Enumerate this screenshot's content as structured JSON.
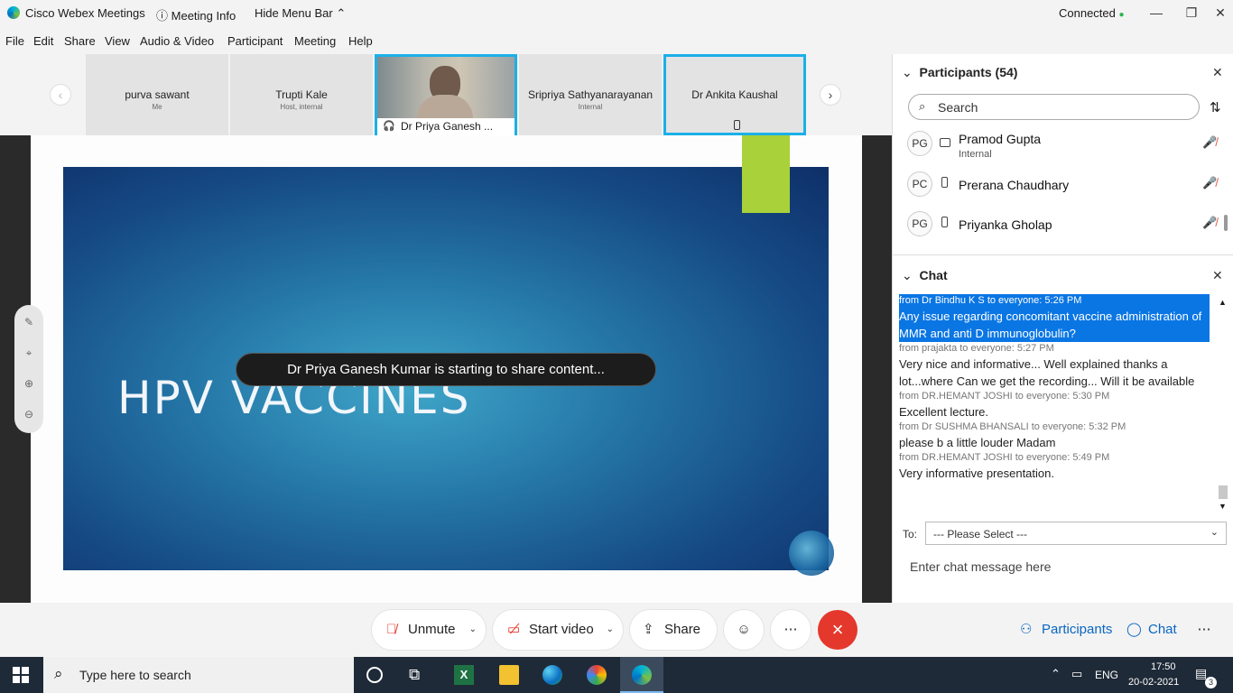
{
  "titlebar": {
    "app_name": "Cisco Webex Meetings",
    "meeting_info": "Meeting Info",
    "hide_menu_bar": "Hide Menu Bar",
    "status": "Connected",
    "status_color": "#2db34a"
  },
  "menu": [
    "File",
    "Edit",
    "Share",
    "View",
    "Audio & Video",
    "Participant",
    "Meeting",
    "Help"
  ],
  "strip": {
    "tiles": [
      {
        "name": "purva sawant",
        "sub": "Me"
      },
      {
        "name": "Trupti Kale",
        "sub": "Host, internal"
      },
      {
        "name": "Dr Priya Ganesh ...",
        "sub": ""
      },
      {
        "name": "Sripriya Sathyanarayanan",
        "sub": "Internal"
      },
      {
        "name": "Dr Ankita Kaushal",
        "sub": ""
      }
    ]
  },
  "share": {
    "slide_title": "HPV VACCINES",
    "toast": "Dr Priya Ganesh Kumar is starting to share content..."
  },
  "participants_panel": {
    "title": "Participants (54)",
    "search_placeholder": "Search",
    "rows": [
      {
        "initials": "PG",
        "name": "Pramod Gupta",
        "role": "Internal",
        "device": "computer"
      },
      {
        "initials": "PC",
        "name": "Prerana Chaudhary",
        "role": "",
        "device": "phone"
      },
      {
        "initials": "PG",
        "name": "Priyanka Gholap",
        "role": "",
        "device": "phone"
      }
    ]
  },
  "chat_panel": {
    "title": "Chat",
    "messages": [
      {
        "meta": "from Dr Bindhu K S to everyone:    5:26 PM",
        "text": "Any issue regarding concomitant vaccine administration of MMR and anti D immunoglobulin?",
        "highlighted": true
      },
      {
        "meta": "from prajakta to everyone:    5:27 PM",
        "text": "Very nice and informative... Well explained thanks a lot...where Can we get the recording... Will it be available",
        "highlighted": false
      },
      {
        "meta": "from DR.HEMANT JOSHI to everyone:    5:30 PM",
        "text": "Excellent lecture.",
        "highlighted": false
      },
      {
        "meta": "from Dr SUSHMA BHANSALI to everyone:    5:32 PM",
        "text": "please b a little louder Madam",
        "highlighted": false
      },
      {
        "meta": "from DR.HEMANT JOSHI to everyone:    5:49 PM",
        "text": "Very informative presentation.",
        "highlighted": false
      }
    ],
    "to_label": "To:",
    "to_value": "--- Please Select ---",
    "input_placeholder": "Enter chat message here"
  },
  "controls": {
    "unmute": "Unmute",
    "start_video": "Start video",
    "share": "Share",
    "participants": "Participants",
    "chat": "Chat",
    "more": "⋯"
  },
  "taskbar": {
    "search_placeholder": "Type here to search",
    "lang": "ENG",
    "time": "17:50",
    "date": "20-02-2021",
    "notifications": "3"
  }
}
